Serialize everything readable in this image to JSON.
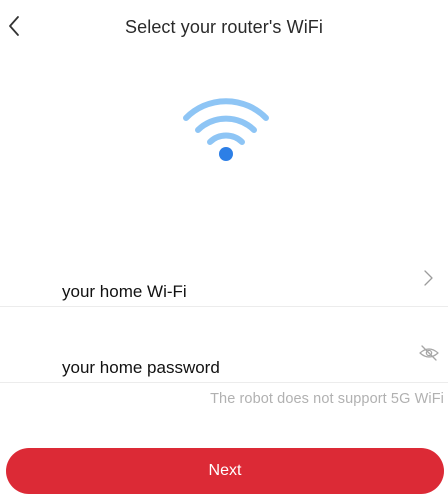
{
  "header": {
    "title": "Select your router's WiFi",
    "back_icon": "chevron-left-icon"
  },
  "illustration": {
    "icon": "wifi-icon",
    "arc_color": "#8ec5f5",
    "dot_color": "#2d7fe6"
  },
  "form": {
    "ssid_value": "your home Wi-Fi",
    "ssid_icon": "chevron-right-icon",
    "password_value": "your home password",
    "password_icon": "eye-off-icon",
    "hint": "The robot does not support 5G WiFi"
  },
  "footer": {
    "next_label": "Next",
    "accent": "#dc2a36"
  }
}
